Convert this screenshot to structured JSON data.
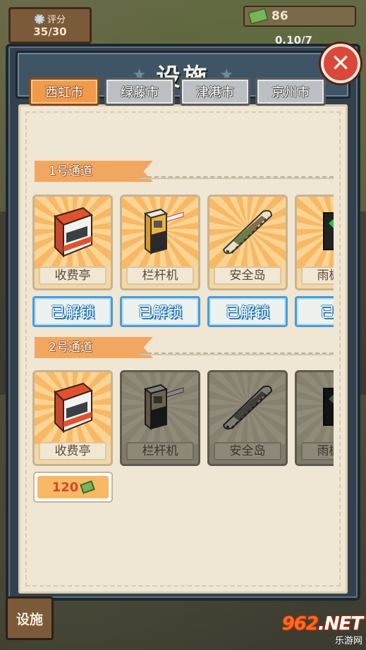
{
  "hud": {
    "score_label": "评分",
    "score_value": "35/30",
    "money_value": "86",
    "secondary_value": "0.10/7"
  },
  "modal": {
    "title": "设施",
    "close_icon": "close-x-icon",
    "tabs": [
      {
        "label": "西虹市",
        "active": true
      },
      {
        "label": "绿藤市",
        "active": false
      },
      {
        "label": "津港市",
        "active": false
      },
      {
        "label": "京州市",
        "active": false
      }
    ],
    "lanes": [
      {
        "title": "1号通道",
        "facilities": [
          {
            "name": "收费亭",
            "icon": "toll-booth-icon",
            "locked": false
          },
          {
            "name": "栏杆机",
            "icon": "barrier-gate-icon",
            "locked": false
          },
          {
            "name": "安全岛",
            "icon": "safety-island-icon",
            "locked": false
          },
          {
            "name": "雨棚信",
            "icon": "canopy-signal-icon",
            "locked": false
          }
        ],
        "unlock_labels": [
          "已解锁",
          "已解锁",
          "已解锁",
          "已解"
        ]
      },
      {
        "title": "2号通道",
        "facilities": [
          {
            "name": "收费亭",
            "icon": "toll-booth-icon",
            "locked": false
          },
          {
            "name": "栏杆机",
            "icon": "barrier-gate-icon",
            "locked": true
          },
          {
            "name": "安全岛",
            "icon": "safety-island-icon",
            "locked": true
          },
          {
            "name": "雨棚信",
            "icon": "canopy-signal-icon",
            "locked": true
          }
        ],
        "price": "120"
      }
    ]
  },
  "bottom_button_label": "设施",
  "watermark": {
    "logo_num": "962",
    "logo_text": ".NET",
    "sub": "乐游网"
  }
}
